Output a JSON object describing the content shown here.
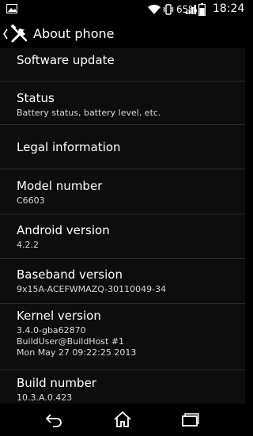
{
  "status_bar": {
    "battery_percent": "65%",
    "time": "18:24",
    "icons": [
      "notification-image-icon",
      "wifi-icon",
      "vibrate-icon",
      "signal-icon",
      "battery-icon"
    ]
  },
  "action_bar": {
    "title": "About phone",
    "icon": "tools-icon"
  },
  "items": [
    {
      "label": "Software update"
    },
    {
      "label": "Status",
      "sub": "Battery status, battery level, etc."
    },
    {
      "label": "Legal information"
    },
    {
      "label": "Model number",
      "sub": "C6603"
    },
    {
      "label": "Android version",
      "sub": "4.2.2"
    },
    {
      "label": "Baseband version",
      "sub": "9x15A-ACEFWMAZQ-30110049-34"
    },
    {
      "label": "Kernel version",
      "sub": [
        "3.4.0-gba62870",
        "BuildUser@BuildHost #1",
        "Mon May 27 09:22:25 2013"
      ]
    },
    {
      "label": "Build number",
      "sub": "10.3.A.0.423"
    }
  ],
  "nav_bar": {
    "buttons": [
      "back-icon",
      "home-icon",
      "recent-apps-icon"
    ]
  }
}
